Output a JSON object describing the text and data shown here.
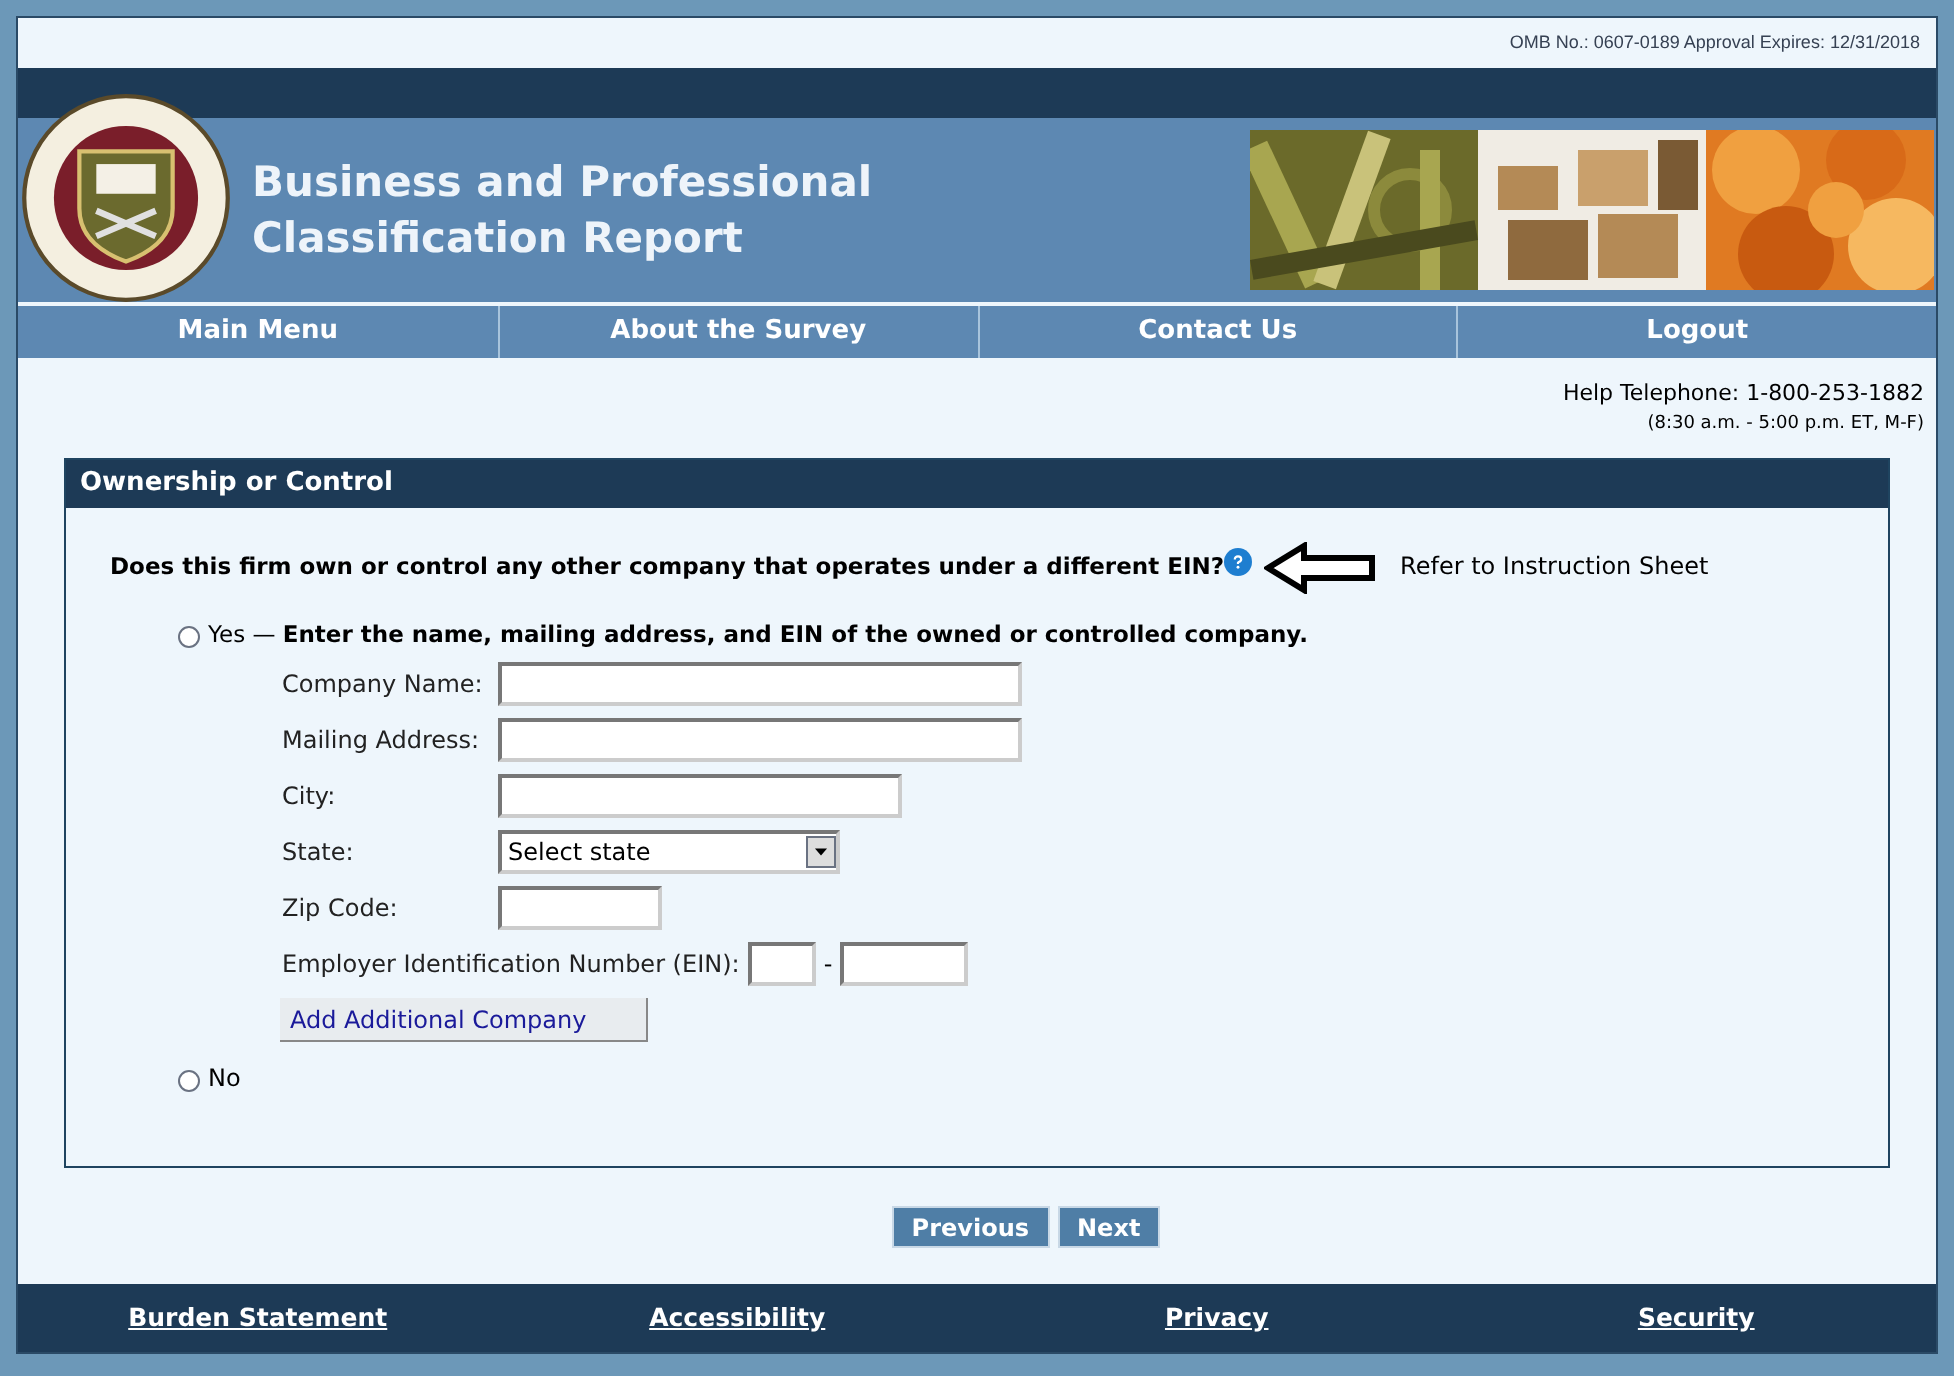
{
  "omb_notice": "OMB No.: 0607-0189 Approval Expires: 12/31/2018",
  "header": {
    "title_lines": [
      "Business and Professional",
      "Classification Report"
    ],
    "photos": [
      {
        "kind": "picture"
      },
      {
        "kind": "picture"
      },
      {
        "kind": "picture"
      }
    ]
  },
  "nav": [
    "Main Menu",
    "About the Survey",
    "Contact Us",
    "Logout"
  ],
  "help": {
    "telephone": "Help Telephone: 1-800-253-1882",
    "hours": "(8:30 a.m. - 5:00 p.m. ET, M-F)"
  },
  "panel": {
    "title": "Ownership or Control",
    "question": "Does this firm own or control any other company that operates under a different EIN?",
    "instruction": "Refer to Instruction Sheet",
    "options": [
      {
        "label": "Yes — **Enter the name, mailing address, and EIN of the owned or controlled company.**",
        "selected": false
      },
      {
        "label": "No",
        "selected": false
      }
    ],
    "fields": [
      {
        "kind": "long",
        "label": "Company Name:"
      },
      {
        "kind": "long",
        "label": "Mailing Address:"
      },
      {
        "kind": "medium",
        "label": "City:"
      },
      {
        "kind": "select",
        "label": "State:",
        "placeholder": "Select state"
      },
      {
        "kind": "short",
        "label": "Zip Code:"
      },
      {
        "kind": "ein",
        "label": "Employer Identification Number (EIN):",
        "separator": "-"
      }
    ],
    "add_button": "Add Additional Company"
  },
  "buttons": [
    "Previous",
    "Next"
  ],
  "footer": [
    "Burden Statement",
    "Accessibility",
    "Privacy",
    "Security"
  ]
}
